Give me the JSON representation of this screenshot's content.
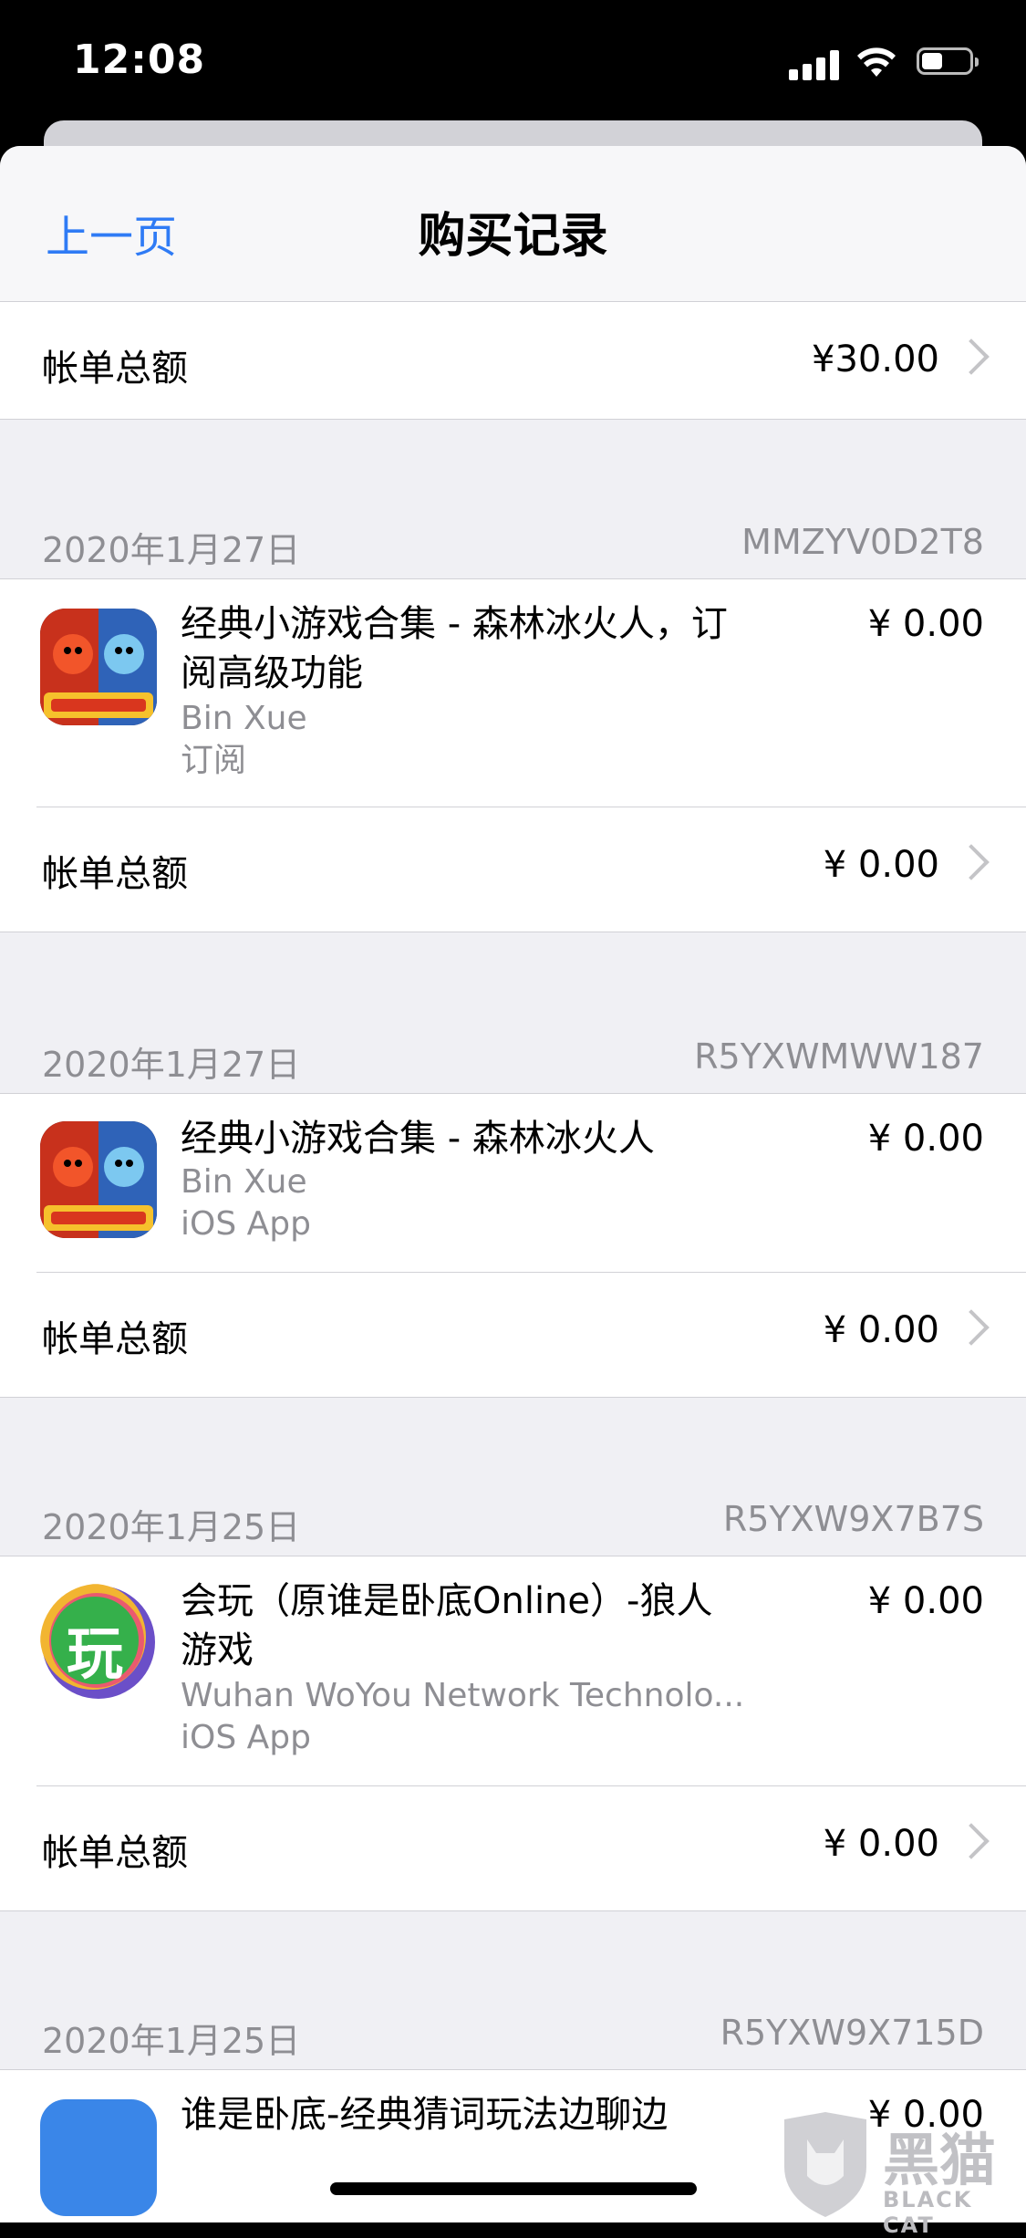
{
  "status_bar": {
    "time": "12:08",
    "icons": [
      "signal-icon",
      "wifi-icon",
      "battery-icon"
    ]
  },
  "nav": {
    "back_label": "上一页",
    "title": "购买记录"
  },
  "top_total": {
    "label": "帐单总额",
    "amount": "¥30.00"
  },
  "purchases": [
    {
      "date": "2020年1月27日",
      "order_id": "MMZYV0D2T8",
      "items": [
        {
          "title": "经典小游戏合集 - 森林冰火人，订阅高级功能",
          "developer": "Bin Xue",
          "type": "订阅",
          "price": "¥ 0.00",
          "icon": "fireboy-watergirl-app-icon"
        }
      ],
      "total_label": "帐单总额",
      "total_amount": "¥ 0.00"
    },
    {
      "date": "2020年1月27日",
      "order_id": "R5YXWMWW187",
      "items": [
        {
          "title": "经典小游戏合集 - 森林冰火人",
          "developer": "Bin Xue",
          "type": "iOS App",
          "price": "¥ 0.00",
          "icon": "fireboy-watergirl-app-icon"
        }
      ],
      "total_label": "帐单总额",
      "total_amount": "¥ 0.00"
    },
    {
      "date": "2020年1月25日",
      "order_id": "R5YXW9X7B7S",
      "items": [
        {
          "title": "会玩（原谁是卧底Online）-狼人游戏",
          "developer": "Wuhan WoYou Network Technolo...",
          "type": "iOS App",
          "price": "¥ 0.00",
          "icon": "huiwan-app-icon",
          "icon_glyph": "玩"
        }
      ],
      "total_label": "帐单总额",
      "total_amount": "¥ 0.00"
    },
    {
      "date": "2020年1月25日",
      "order_id": "R5YXW9X715D",
      "items": [
        {
          "title": "谁是卧底-经典猜词玩法边聊边",
          "price": "¥ 0.00",
          "icon": "shuishiwodi-app-icon"
        }
      ]
    }
  ],
  "watermark": {
    "main": "黑猫",
    "sub": "BLACK CAT"
  }
}
